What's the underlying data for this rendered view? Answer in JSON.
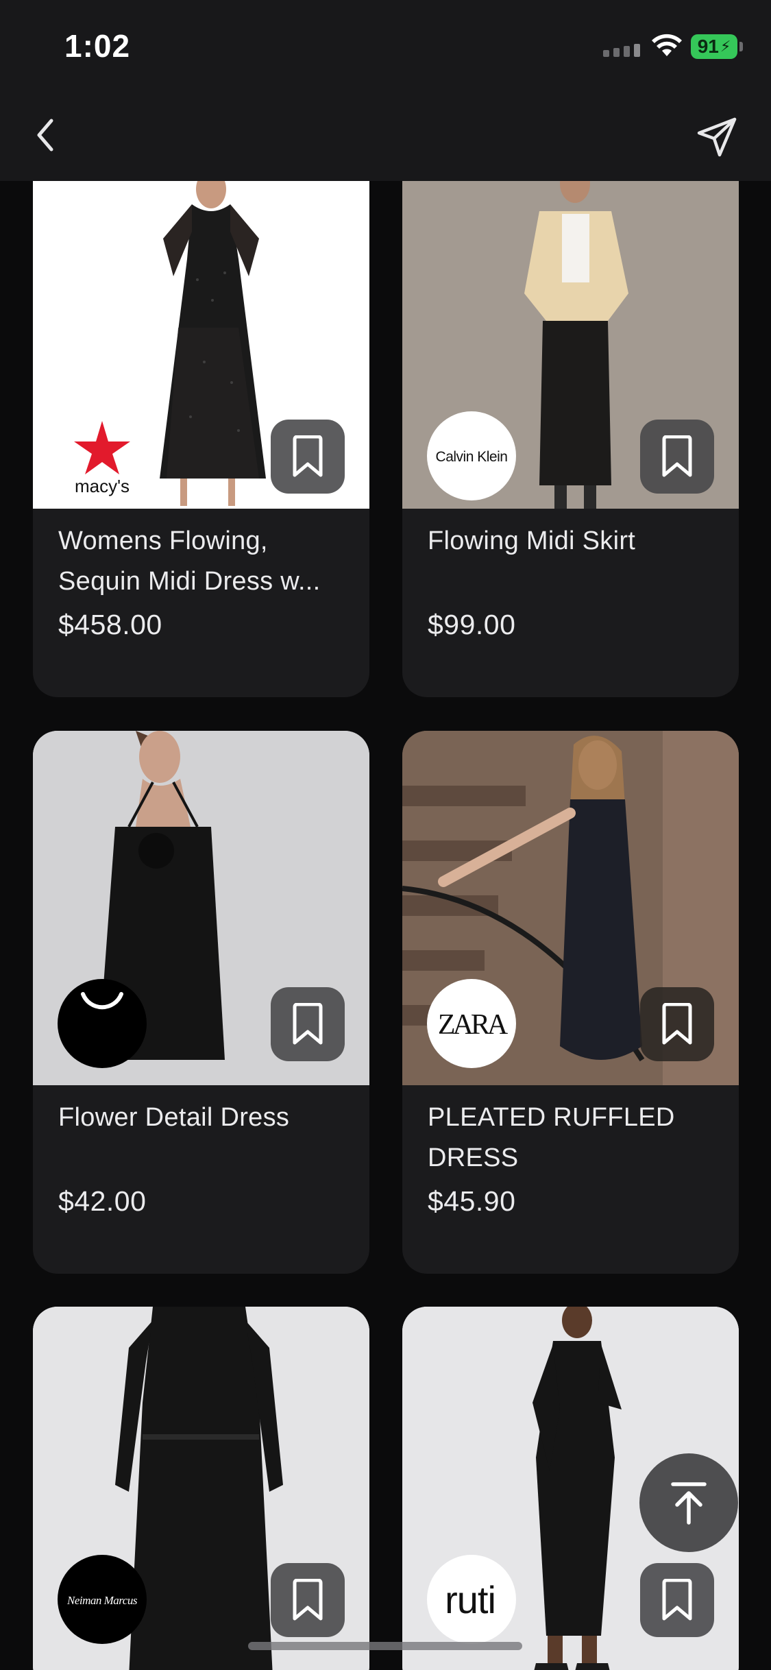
{
  "status_bar": {
    "time": "1:02",
    "battery": "91"
  },
  "nav": {
    "back_icon": "chevron-left-icon",
    "share_icon": "paper-plane-icon"
  },
  "products": [
    {
      "title": "Womens Flowing, Sequin Midi Dress w...",
      "price": "$458.00",
      "brand": "macy's",
      "logo_icon": "macys-star-logo"
    },
    {
      "title": "Flowing Midi Skirt",
      "price": "$99.00",
      "brand": "Calvin Klein",
      "logo_icon": "calvin-klein-logo"
    },
    {
      "title": "Flower Detail Dress",
      "price": "$42.00",
      "brand": "",
      "logo_icon": "smile-arc-logo"
    },
    {
      "title": "PLEATED RUFFLED DRESS",
      "price": "$45.90",
      "brand": "ZARA",
      "logo_icon": "zara-logo"
    },
    {
      "title": "",
      "price": "",
      "brand": "Neiman Marcus",
      "logo_icon": "neiman-marcus-logo"
    },
    {
      "title": "",
      "price": "",
      "brand": "ruti",
      "logo_icon": "ruti-logo"
    }
  ],
  "scroll_top_icon": "arrow-up-to-line-icon",
  "colors": {
    "background": "#0b0b0c",
    "card": "#1b1b1d",
    "battery": "#35c759",
    "macys_red": "#e21a2c"
  }
}
